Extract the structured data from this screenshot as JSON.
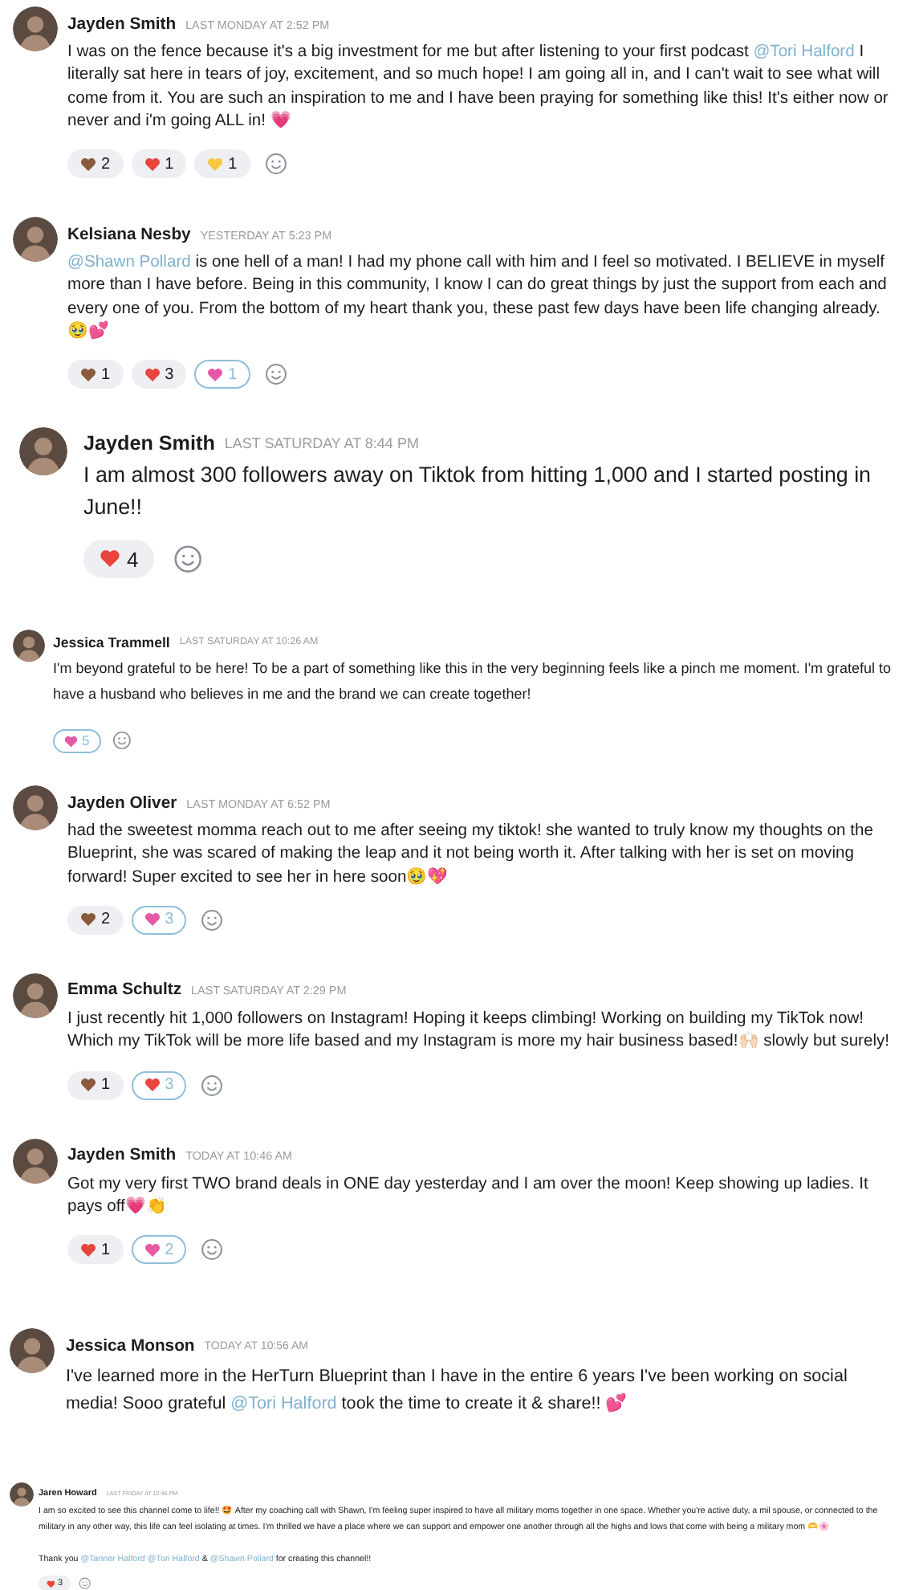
{
  "posts": [
    {
      "kind": "medium",
      "author": "Jayden Smith",
      "time": "LAST MONDAY AT 2:52 PM",
      "body": [
        {
          "kind": "text",
          "text": "I was on the fence because it's a big investment for me but after listening to your first podcast "
        },
        {
          "kind": "mention",
          "text": "@Tori Halford"
        },
        {
          "kind": "text",
          "text": " I literally sat here in tears of joy, excitement, and so much hope! I am going all in, and I can't wait to see what will come from it. You are such an inspiration to me and I have been praying for something like this! It's either now or never and i'm going ALL in! 💗"
        }
      ],
      "reactions": [
        {
          "color": "#8a5a3b",
          "count": "2",
          "selected": false
        },
        {
          "color": "#e8453c",
          "count": "1",
          "selected": false
        },
        {
          "color": "#f5c842",
          "count": "1",
          "selected": false
        }
      ]
    },
    {
      "kind": "medium",
      "author": "Kelsiana Nesby",
      "time": "YESTERDAY AT 5:23 PM",
      "body": [
        {
          "kind": "mention",
          "text": "@Shawn Pollard"
        },
        {
          "kind": "text",
          "text": " is one hell of a man! I had my phone call with him and I feel so motivated. I BELIEVE in myself more than I have before. Being in this community, I know I can do great things by just the support from each and every one of you. From the bottom of my heart thank you, these past few days have been life changing already. 🥹💕"
        }
      ],
      "reactions": [
        {
          "color": "#8a5a3b",
          "count": "1",
          "selected": false
        },
        {
          "color": "#e8453c",
          "count": "3",
          "selected": false
        },
        {
          "color": "#e65aa5",
          "count": "1",
          "selected": true
        }
      ]
    },
    {
      "kind": "large",
      "author": "Jayden Smith",
      "time": "LAST SATURDAY AT 8:44 PM",
      "body": [
        {
          "kind": "text",
          "text": "I am almost 300 followers away on Tiktok from hitting 1,000 and I started posting in June!!"
        }
      ],
      "reactions": [
        {
          "color": "#e8453c",
          "count": "4",
          "selected": false
        }
      ]
    },
    {
      "kind": "small",
      "author": "Jessica Trammell",
      "time": "LAST SATURDAY AT 10:26 AM",
      "body": [
        {
          "kind": "text",
          "text": "I'm beyond grateful to be here! To be a part of something like this in the very beginning feels like a pinch me moment. I'm grateful to have a husband who believes in me and the brand we can create together!"
        }
      ],
      "reactions": [
        {
          "color": "#e65aa5",
          "count": "5",
          "selected": true
        }
      ]
    },
    {
      "kind": "medium",
      "author": "Jayden Oliver",
      "time": "LAST MONDAY AT 6:52 PM",
      "body": [
        {
          "kind": "text",
          "text": "had the sweetest momma reach out to me after seeing my tiktok! she wanted to truly know my thoughts on the Blueprint, she was scared of making the leap and it not being worth it. After talking with her is set on moving forward! Super excited to see her in here soon🥹💖"
        }
      ],
      "reactions": [
        {
          "color": "#8a5a3b",
          "count": "2",
          "selected": false
        },
        {
          "color": "#e65aa5",
          "count": "3",
          "selected": true
        }
      ]
    },
    {
      "kind": "medium",
      "author": "Emma Schultz",
      "time": "LAST SATURDAY AT 2:29 PM",
      "body": [
        {
          "kind": "text",
          "text": "I just recently hit 1,000 followers on Instagram! Hoping it keeps climbing! Working on building my TikTok now! Which my TikTok will be more life based and my Instagram is more my hair business based!🙌🏻 slowly but surely!"
        }
      ],
      "reactions": [
        {
          "color": "#8a5a3b",
          "count": "1",
          "selected": false
        },
        {
          "color": "#e8453c",
          "count": "3",
          "selected": true
        }
      ]
    },
    {
      "kind": "medium",
      "author": "Jayden Smith",
      "time": "TODAY AT 10:46 AM",
      "body": [
        {
          "kind": "text",
          "text": "Got my very first TWO brand deals in ONE day yesterday and I am over the moon! Keep showing up ladies. It pays off💗👏"
        }
      ],
      "reactions": [
        {
          "color": "#e8453c",
          "count": "1",
          "selected": false
        },
        {
          "color": "#e65aa5",
          "count": "2",
          "selected": true
        }
      ]
    },
    {
      "kind": "wide",
      "author": "Jessica Monson",
      "time": "TODAY AT 10:56 AM",
      "body": [
        {
          "kind": "text",
          "text": "I've learned more in the HerTurn Blueprint than I have in the entire 6 years I've been working on social media! Sooo grateful "
        },
        {
          "kind": "mention",
          "text": "@Tori Halford"
        },
        {
          "kind": "text",
          "text": " took the time to create it & share!! 💕"
        }
      ]
    },
    {
      "kind": "tiny",
      "author": "Jaren Howard",
      "time": "LAST FRIDAY AT 12:46 PM",
      "body": [
        {
          "kind": "text",
          "text": "I am so excited to see this channel come to life!! 🤩 After my coaching call with Shawn, I'm feeling super inspired to have all military moms together in one space. Whether you're active duty, a mil spouse, or connected to the military in any other way, this life can feel isolating at times. I'm thrilled we have a place where we can support and empower one another through all the highs and lows that come with being a military mom 🫶🌸"
        }
      ],
      "body_2": [
        {
          "kind": "text",
          "text": "Thank you "
        },
        {
          "kind": "mention",
          "text": "@Tanner Halford"
        },
        {
          "kind": "mention",
          "text": "@Tori Halford"
        },
        {
          "kind": "text",
          "text": " & "
        },
        {
          "kind": "mention",
          "text": "@Shawn Pollard"
        },
        {
          "kind": "text",
          "text": " for creating this channel!!"
        }
      ],
      "reactions": [
        {
          "color": "#e8453c",
          "count": "3",
          "selected": false
        }
      ]
    }
  ]
}
